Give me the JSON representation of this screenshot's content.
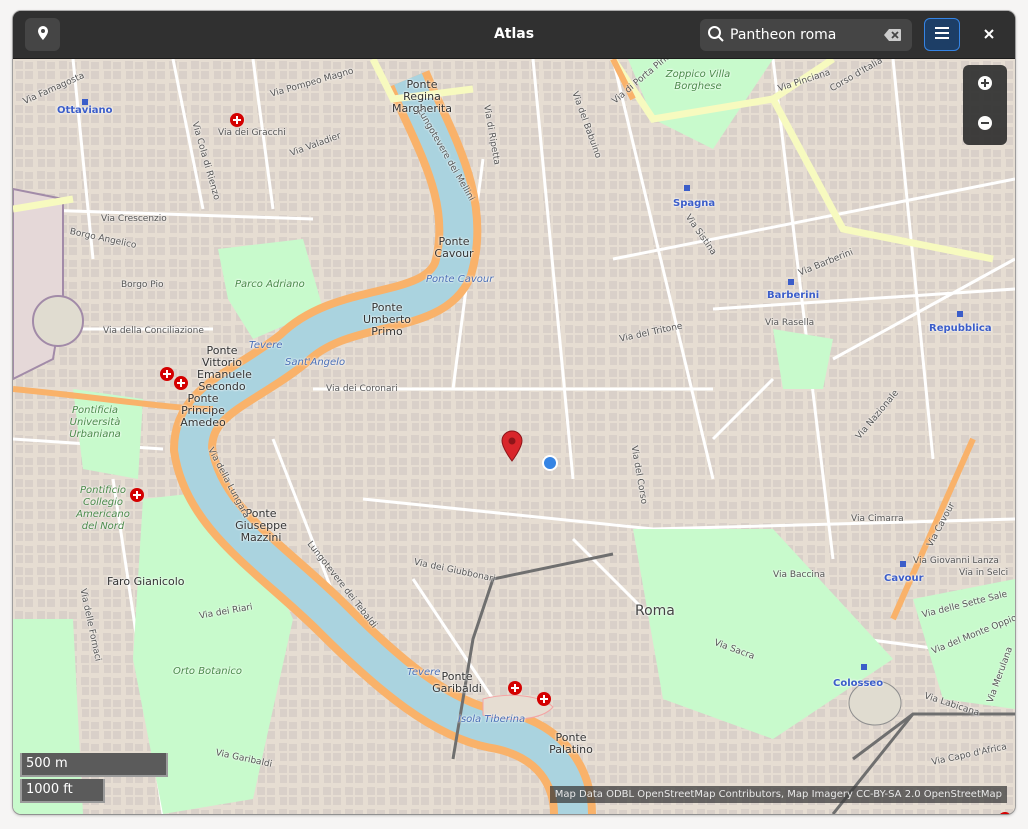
{
  "header": {
    "title": "Atlas",
    "location_icon": "map-marker-icon",
    "search": {
      "value": "Pantheon roma",
      "placeholder": ""
    },
    "menu_icon": "hamburger-menu-icon",
    "close_icon": "close-icon"
  },
  "map": {
    "labels": {
      "ottaviano": "Ottaviano",
      "spagna": "Spagna",
      "barberini": "Barberini",
      "repubblica": "Repubblica",
      "cavour_metro": "Cavour",
      "colosseo": "Colosseo",
      "roma": "Roma",
      "ponte_cavour": "Ponte Cavour",
      "sant_angelo": "Sant'Angelo",
      "isola_tiberina": "Isola Tiberina",
      "tevere1": "Tevere",
      "tevere2": "Tevere",
      "parco_adriano": "Parco Adriano",
      "orto_botanico": "Orto Botanico",
      "villa_borghese": "Zoppico Villa Borghese",
      "faro": "Faro Gianicolo",
      "pontificia": "Pontificia Università Urbaniana",
      "pontificio": "Pontificio Collegio Americano del Nord",
      "ponte_regina": "Ponte Regina Margherita",
      "ponte_cavour_br": "Ponte Cavour",
      "ponte_umberto": "Ponte Umberto Primo",
      "ponte_vittorio": "Ponte Vittorio Emanuele Secondo",
      "ponte_amedeo": "Ponte Principe Amedeo",
      "ponte_mazzini": "Ponte Giuseppe Mazzini",
      "ponte_garibaldi": "Ponte Garibaldi",
      "ponte_palatino": "Ponte Palatino",
      "lungotevere_mellini": "Lungotevere dei Mellini",
      "lungotevere_tebaldi": "Lungotevere dei Tebaldi",
      "via_crescenzio": "Via Crescenzio",
      "via_conciliazione": "Via della Conciliazione",
      "via_coronari": "Via dei Coronari",
      "via_barberini": "Via Barberini",
      "via_nazionale": "Via Nazionale",
      "via_cavour": "Via Cavour",
      "via_lanza": "Via Giovanni Lanza",
      "via_labicana": "Via Labicana",
      "via_gracchi": "Via dei Gracchi",
      "via_sistina": "Via Sistina",
      "via_tritone": "Via del Tritone",
      "via_cimarra": "Via Cimarra",
      "via_baccina": "Via Baccina",
      "via_sacra": "Via Sacra",
      "via_rasella": "Via Rasella",
      "borgo_pio": "Borgo Pio",
      "borgo_angelico": "Borgo Angelico",
      "via_pinciana": "Via Pinciana",
      "corso_ditalia": "Corso d'Italia",
      "via_porta_pinciana": "Via di Porta Pinciana",
      "via_del_corso": "Via del Corso",
      "via_lungara": "Via della Lungara",
      "via_fornaci": "Via delle Fornaci",
      "via_riari": "Via dei Riari",
      "via_giubbonari": "Via dei Giubbonari",
      "via_sette_sale": "Via delle Sette Sale",
      "via_capo_dafrica": "Via Capo d'Africa",
      "via_in_selci": "Via in Selci",
      "via_monte_oppio": "Via del Monte Oppio",
      "via_garibaldi": "Via Garibaldi",
      "via_ripetta": "Via di Ripetta",
      "via_babuino": "Via del Babuino",
      "via_merulana": "Via Merulana",
      "via_cola_rienzo": "Via Cola di Rienzo",
      "via_valadier": "Via Valadier",
      "via_pompeo_magno": "Via Pompeo Magno",
      "via_famagosta": "Via Famagosta"
    },
    "zoom_in_icon": "plus-icon",
    "zoom_out_icon": "minus-icon",
    "scale_metric": "500 m",
    "scale_imperial": "1000 ft",
    "attribution": "Map Data ODBL OpenStreetMap Contributors, Map Imagery CC-BY-SA 2.0 OpenStreetMap"
  },
  "colors": {
    "headerbar": "#303030",
    "accent": "#3584e4",
    "river": "#aad3df",
    "river_bank": "#f9b26a",
    "park": "#c8facc",
    "road_major": "#f7fabf",
    "marker": "#d9262b",
    "current_location": "#3584e4"
  }
}
